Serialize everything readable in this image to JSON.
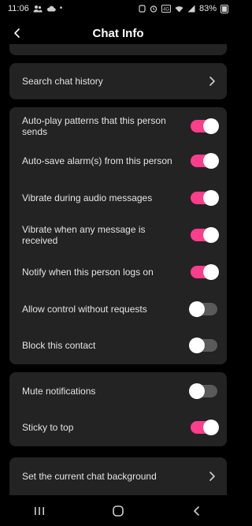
{
  "status_bar": {
    "time": "11:06",
    "battery": "83%",
    "icons": [
      "people-icon",
      "cloud-icon",
      "dot-icon",
      "notification-icon",
      "alarm-icon",
      "volte-icon",
      "wifi-icon",
      "signal-icon",
      "battery-icon"
    ]
  },
  "header": {
    "title": "Chat Info"
  },
  "search_card": {
    "label": "Search chat history"
  },
  "settings": [
    {
      "label": "Auto-play patterns that this person sends",
      "on": true
    },
    {
      "label": "Auto-save alarm(s) from this person",
      "on": true
    },
    {
      "label": "Vibrate during audio messages",
      "on": true
    },
    {
      "label": "Vibrate when any message is received",
      "on": true
    },
    {
      "label": "Notify when this person logs on",
      "on": true
    },
    {
      "label": "Allow control without requests",
      "on": false
    },
    {
      "label": "Block this contact",
      "on": false
    }
  ],
  "notifications": [
    {
      "label": "Mute notifications",
      "on": false
    },
    {
      "label": "Sticky to top",
      "on": true
    }
  ],
  "background_card": {
    "label": "Set the current chat background"
  },
  "colors": {
    "accent": "#ff3d8a",
    "card": "#232323",
    "background": "#000000"
  }
}
